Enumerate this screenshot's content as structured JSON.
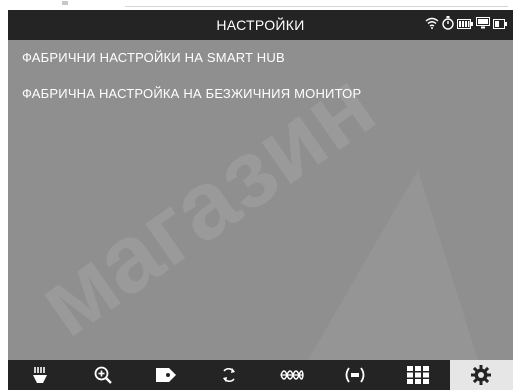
{
  "header": {
    "title": "НАСТРОЙКИ",
    "status_icons": [
      "wifi-icon",
      "stopwatch-icon",
      "battery-icon",
      "monitor-icon",
      "battery-small-icon"
    ]
  },
  "menu": {
    "items": [
      {
        "label": "ФАБРИЧНИ НАСТРОЙКИ НА SMART HUB"
      },
      {
        "label": "ФАБРИЧНА НАСТРОЙКА НА БЕЗЖИЧНИЯ МОНИТОР"
      }
    ]
  },
  "watermark": {
    "text": "магазин"
  },
  "toolbar": {
    "items": [
      {
        "icon": "brush-icon",
        "active": false
      },
      {
        "icon": "zoom-in-icon",
        "active": false
      },
      {
        "icon": "tag-icon",
        "active": false
      },
      {
        "icon": "rotate-icon",
        "active": false
      },
      {
        "icon": "wave-icon",
        "active": false
      },
      {
        "icon": "signal-icon",
        "active": false
      },
      {
        "icon": "grid-icon",
        "active": false
      },
      {
        "icon": "settings-icon",
        "active": true
      }
    ]
  },
  "colors": {
    "background": "#8f8f8f",
    "bar": "#242424",
    "active_tab": "#e6e6e6",
    "text": "#ffffff"
  }
}
